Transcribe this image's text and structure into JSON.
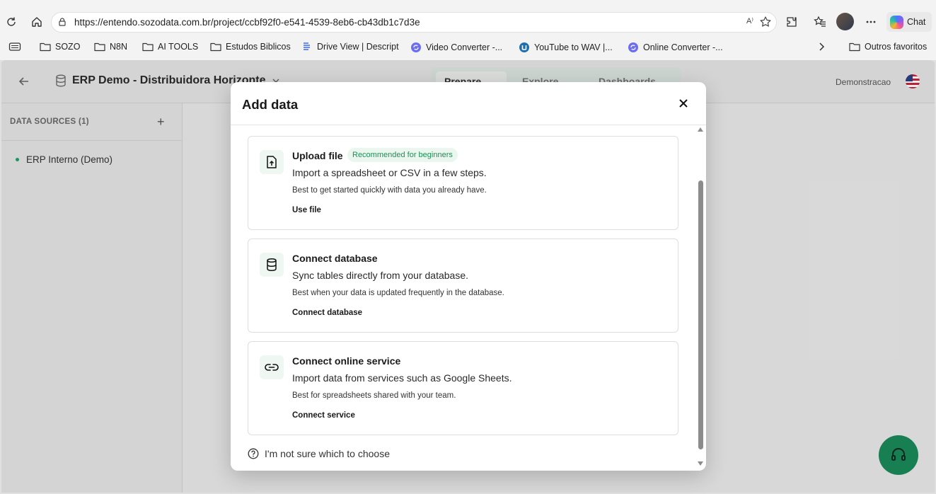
{
  "browser": {
    "url": "https://entendo.sozodata.com.br/project/ccbf92f0-e541-4539-8eb6-cb43db1c7d3e",
    "read_aloud_label": "A⁾",
    "chat_label": "Chat"
  },
  "bookmarks": [
    {
      "label": "SOZO",
      "icon": "folder-icon"
    },
    {
      "label": "N8N",
      "icon": "folder-icon"
    },
    {
      "label": "AI TOOLS",
      "icon": "folder-icon"
    },
    {
      "label": "Estudos Biblicos",
      "icon": "folder-icon"
    },
    {
      "label": "Drive View | Descript",
      "icon": "descript-icon"
    },
    {
      "label": "Video Converter -...",
      "icon": "converter-icon"
    },
    {
      "label": "YouTube to WAV |...",
      "icon": "youtube-wav-icon"
    },
    {
      "label": "Online Converter -...",
      "icon": "converter-icon"
    },
    {
      "label": "Outros favoritos",
      "icon": "folder-icon"
    }
  ],
  "app": {
    "project_title": "ERP Demo - Distribuidora Horizonte",
    "tabs": [
      {
        "label": "Prepare",
        "active": true
      },
      {
        "label": "Explore",
        "active": false
      },
      {
        "label": "Dashboards",
        "active": false
      }
    ],
    "user_label": "Demonstracao"
  },
  "sidebar": {
    "heading": "DATA SOURCES (1)",
    "add_label": "+",
    "sources": [
      "ERP Interno (Demo)"
    ]
  },
  "modal": {
    "title": "Add data",
    "options": [
      {
        "title": "Upload file",
        "badge": "Recommended for beginners",
        "description": "Import a spreadsheet or CSV in a few steps.",
        "subtext": "Best to get started quickly with data you already have.",
        "action": "Use file",
        "icon": "file-upload-icon"
      },
      {
        "title": "Connect database",
        "description": "Sync tables directly from your database.",
        "subtext": "Best when your data is updated frequently in the database.",
        "action": "Connect database",
        "icon": "database-icon"
      },
      {
        "title": "Connect online service",
        "description": "Import data from services such as Google Sheets.",
        "subtext": "Best for spreadsheets shared with your team.",
        "action": "Connect service",
        "icon": "link-icon"
      }
    ],
    "help_link": "I'm not sure which to choose"
  },
  "colors": {
    "accent": "#198a5a",
    "badge_bg": "#e9f7ee",
    "badge_text": "#1f8f55"
  }
}
